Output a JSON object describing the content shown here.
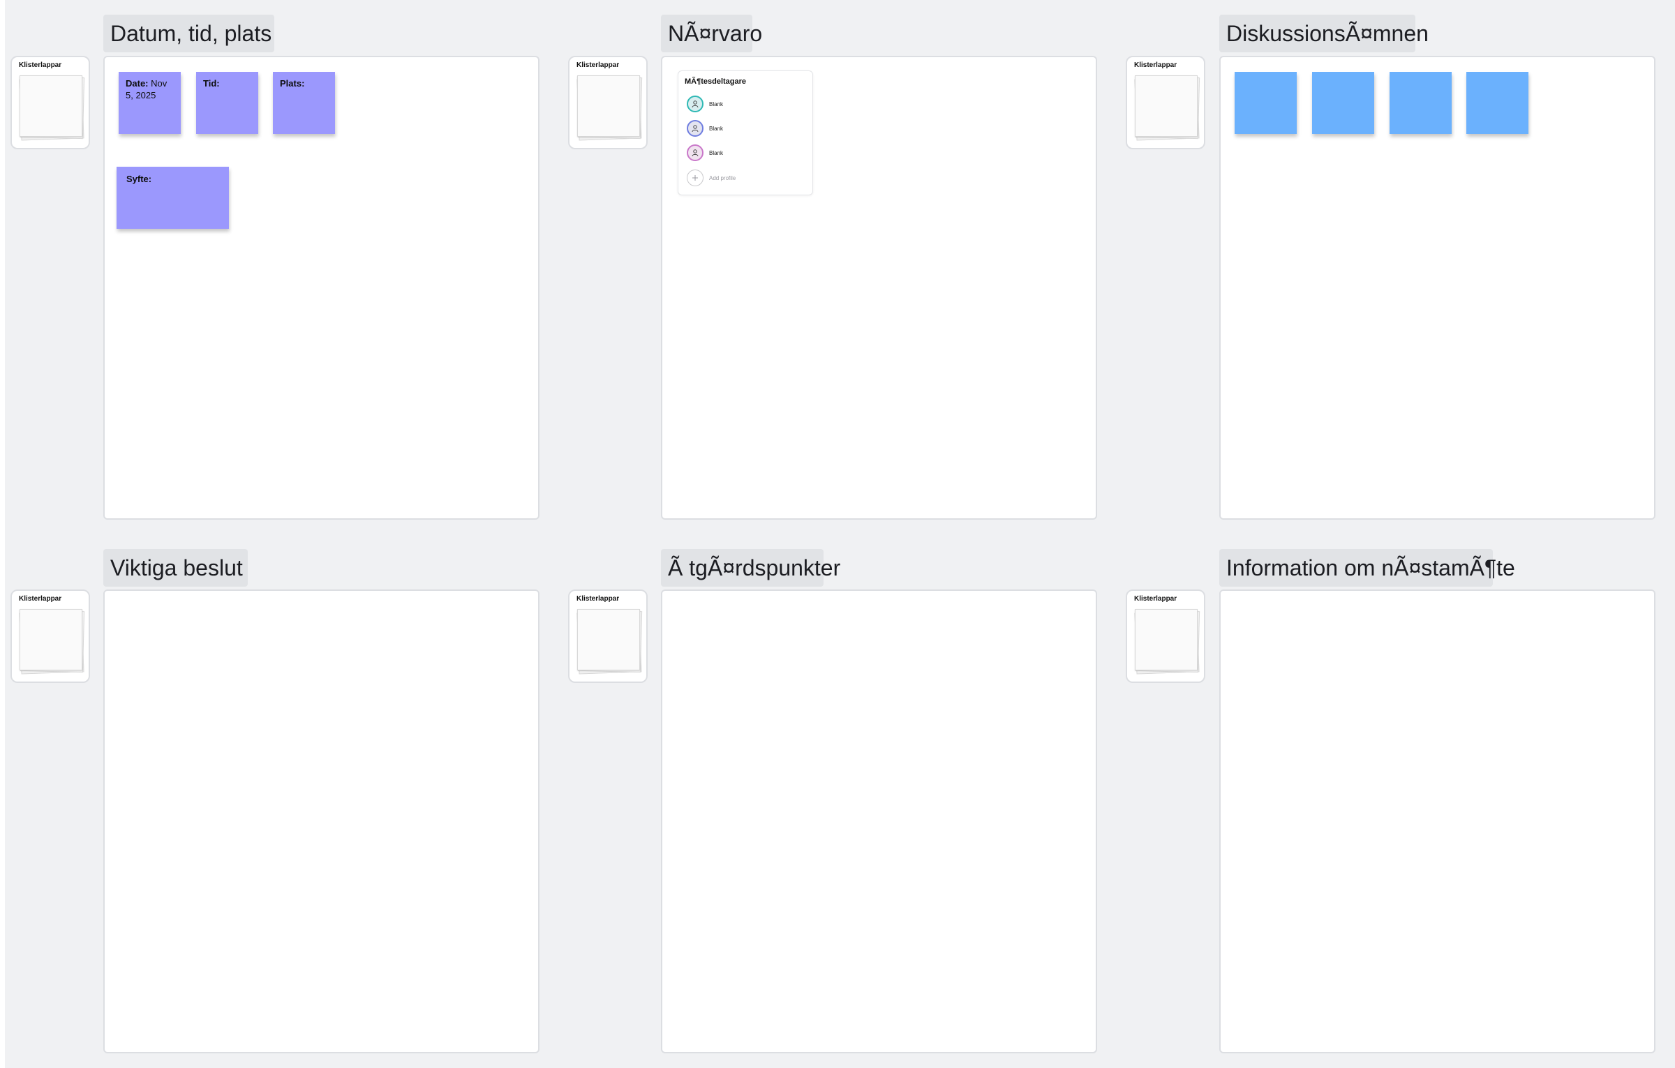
{
  "board": {
    "background_color": "#f0f1f3",
    "stack_label": "Klisterlappar"
  },
  "frames": [
    {
      "title": "Datum, tid, plats"
    },
    {
      "title": "NÃ¤rvaro"
    },
    {
      "title": "DiskussionsÃ¤mnen"
    },
    {
      "title": "Viktiga beslut"
    },
    {
      "title": "Ã  tgÃ¤rdspunkter"
    },
    {
      "title": "Information om nÃ¤stamÃ¶te"
    }
  ],
  "datum_notes": {
    "date_label": "Date:",
    "date_value": " Nov 5, 2025",
    "tid_label": "Tid:",
    "plats_label": "Plats:",
    "syfte_label": "Syfte:",
    "color": "#9b98fd"
  },
  "attendance_card": {
    "title": "MÃ¶tesdeltagare",
    "people": [
      {
        "name": "Blank",
        "ring_color": "#2fb9b4",
        "fill_color": "#d9eef0"
      },
      {
        "name": "Blank",
        "ring_color": "#6f7de0",
        "fill_color": "#e3e4f0"
      },
      {
        "name": "Blank",
        "ring_color": "#c977c9",
        "fill_color": "#f1e3f0"
      }
    ],
    "add_label": "Add profile",
    "icons": {
      "person": "person-icon",
      "add": "plus-icon"
    }
  },
  "discussion_notes": {
    "count": 4,
    "color": "#6bb1fd"
  }
}
